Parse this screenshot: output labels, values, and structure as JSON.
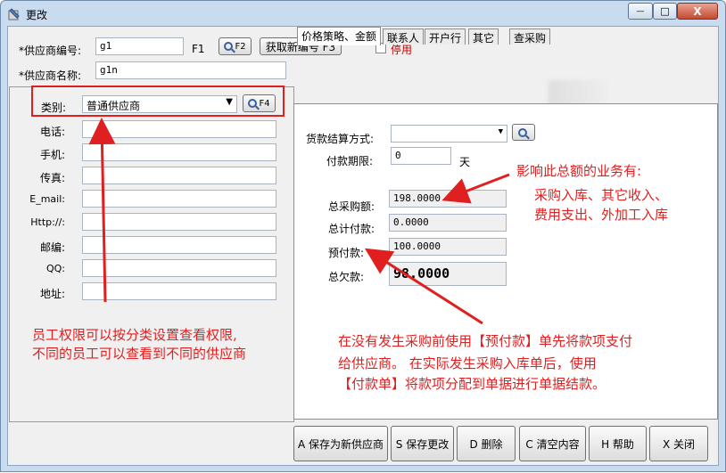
{
  "window": {
    "title": "更改",
    "controls": {
      "minimize": "—",
      "maximize": "□",
      "close": "X"
    }
  },
  "header": {
    "supplier_code_label": "*供应商编号:",
    "supplier_code_value": "g1",
    "f1_label": "F1",
    "f2_button": "F2",
    "get_new_code_button": "获取新编号 F3",
    "disable_label": "停用",
    "supplier_name_label": "*供应商名称:",
    "supplier_name_value": "g1n"
  },
  "left_form": {
    "category_label": "类别:",
    "category_value": "普通供应商",
    "f4_button": "F4",
    "fields": [
      {
        "label": "电话:",
        "value": ""
      },
      {
        "label": "手机:",
        "value": ""
      },
      {
        "label": "传真:",
        "value": ""
      },
      {
        "label": "E_mail:",
        "value": ""
      },
      {
        "label": "Http://:",
        "value": ""
      },
      {
        "label": "邮编:",
        "value": ""
      },
      {
        "label": "QQ:",
        "value": ""
      },
      {
        "label": "地址:",
        "value": ""
      }
    ]
  },
  "tabs": [
    {
      "label": "价格策略、金额",
      "active": true
    },
    {
      "label": "联系人",
      "active": false
    },
    {
      "label": "开户行",
      "active": false
    },
    {
      "label": "其它",
      "active": false
    },
    {
      "label": "查采购",
      "active": false
    }
  ],
  "right_form": {
    "payment_method_label": "货款结算方式:",
    "payment_method_value": "",
    "payment_days_label": "付款期限:",
    "payment_days_value": "0",
    "days_unit": "天",
    "total_purchase_label": "总采购额:",
    "total_purchase_value": "198.0000",
    "total_paid_label": "总计付款:",
    "total_paid_value": "0.0000",
    "prepaid_label": "预付款:",
    "prepaid_value": "100.0000",
    "total_owed_label": "总欠款:",
    "total_owed_value": "98.0000"
  },
  "annotations": {
    "note_amount": [
      "影响此总额的业务有:",
      "采购入库、其它收入、",
      "费用支出、外加工入库"
    ],
    "note_permission": [
      "员工权限可以按分类设置查看权限,",
      "不同的员工可以查看到不同的供应商"
    ],
    "note_prepay": [
      "在没有发生采购前使用【预付款】单先将款项支付",
      "给供应商。  在实际发生采购入库单后，使用",
      "【付款单】将款项分配到单据进行单据结款。"
    ]
  },
  "footer_buttons": [
    {
      "label": "A 保存为新供应商"
    },
    {
      "label": "S 保存更改"
    },
    {
      "label": "D 删除"
    },
    {
      "label": "C 清空内容"
    },
    {
      "label": "H 帮助"
    },
    {
      "label": "X 关闭"
    }
  ],
  "colors": {
    "accent_red": "#e02020",
    "window_frame": "#c9dcef"
  }
}
